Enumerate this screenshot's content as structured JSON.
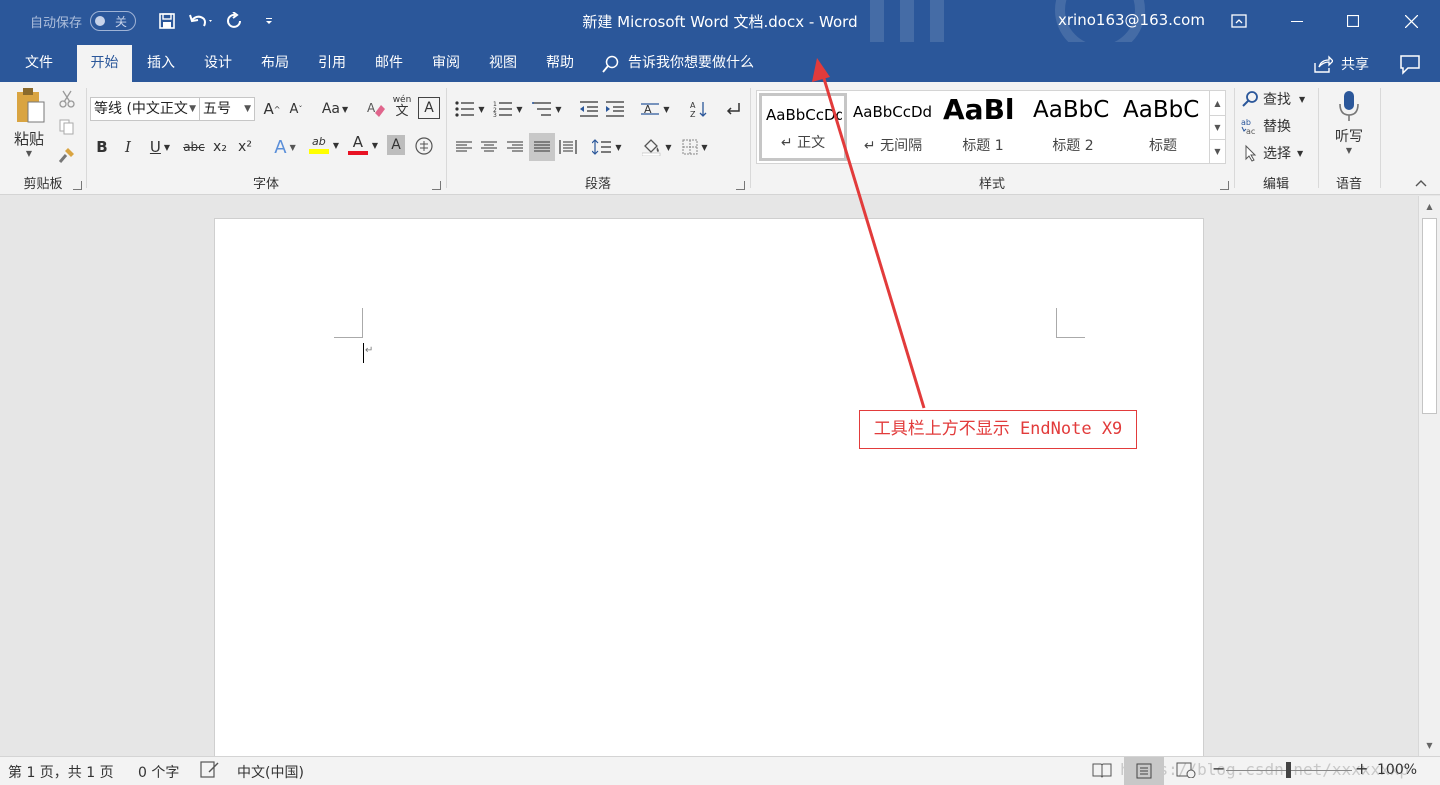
{
  "titlebar": {
    "autosave_label": "自动保存",
    "autosave_state": "关",
    "document_title": "新建 Microsoft Word 文档.docx  -  Word",
    "user": "xrino163@163.com",
    "bg_color": "#2b579a"
  },
  "tabs": [
    {
      "label": "文件",
      "active": false
    },
    {
      "label": "开始",
      "active": true
    },
    {
      "label": "插入",
      "active": false
    },
    {
      "label": "设计",
      "active": false
    },
    {
      "label": "布局",
      "active": false
    },
    {
      "label": "引用",
      "active": false
    },
    {
      "label": "邮件",
      "active": false
    },
    {
      "label": "审阅",
      "active": false
    },
    {
      "label": "视图",
      "active": false
    },
    {
      "label": "帮助",
      "active": false
    }
  ],
  "tell_me": "告诉我你想要做什么",
  "share": "共享",
  "ribbon": {
    "clipboard": {
      "label": "剪贴板",
      "paste": "粘贴"
    },
    "font": {
      "label": "字体",
      "font_name": "等线 (中文正文",
      "font_size": "五号",
      "case_label": "Aa",
      "bold": "B",
      "italic": "I",
      "underline": "U",
      "strike": "abc",
      "sub": "x₂",
      "sup": "x²",
      "text_effect": "A",
      "highlight": "ab",
      "font_color": "A",
      "char_shading": "A",
      "pinyin": "wén",
      "pinyin_char": "文",
      "grow": "A",
      "shrink": "A",
      "border_char": "A"
    },
    "paragraph": {
      "label": "段落"
    },
    "styles": {
      "label": "样式",
      "items": [
        {
          "preview": "AaBbCcDd",
          "name": "↵ 正文"
        },
        {
          "preview": "AaBbCcDd",
          "name": "↵ 无间隔"
        },
        {
          "preview": "AaBl",
          "name": "标题 1"
        },
        {
          "preview": "AaBbC",
          "name": "标题 2"
        },
        {
          "preview": "AaBbC",
          "name": "标题"
        }
      ]
    },
    "editing": {
      "label": "编辑",
      "find": "查找",
      "replace": "替换",
      "select": "选择"
    },
    "voice": {
      "label": "语音",
      "dictate": "听写"
    }
  },
  "document": {
    "paragraph_mark": "↵"
  },
  "annotation": {
    "text": "工具栏上方不显示 EndNote X9",
    "color": "#e23b3b"
  },
  "statusbar": {
    "page": "第 1 页，共 1 页",
    "words": "0 个字",
    "language": "中文(中国)",
    "zoom": "100%",
    "watermark": "https://blog.csdn.net/xxxxxxxp"
  }
}
